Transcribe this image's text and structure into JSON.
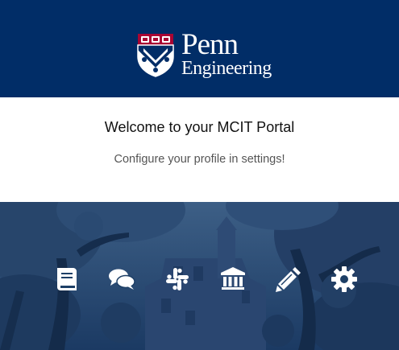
{
  "header": {
    "logo": {
      "line1": "Penn",
      "line2": "Engineering",
      "icon": "penn-shield-icon"
    },
    "background_color": "#012d67"
  },
  "welcome": {
    "title": "Welcome to your MCIT Portal",
    "subtitle": "Configure your profile in settings!"
  },
  "toolbar": {
    "items": [
      {
        "name": "book-icon",
        "label": "Courses"
      },
      {
        "name": "chat-icon",
        "label": "Discussion"
      },
      {
        "name": "slack-icon",
        "label": "Slack"
      },
      {
        "name": "institution-icon",
        "label": "University"
      },
      {
        "name": "pencil-icon",
        "label": "Edit"
      },
      {
        "name": "gear-icon",
        "label": "Settings"
      }
    ]
  },
  "colors": {
    "brand_navy": "#012d67",
    "penn_red": "#990000",
    "icon_color": "#ffffff"
  }
}
